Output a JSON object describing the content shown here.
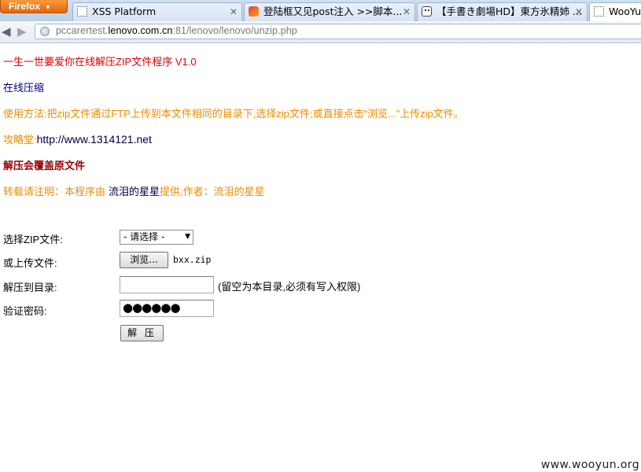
{
  "browser": {
    "app_button": "Firefox",
    "tabs": [
      {
        "label": "XSS Platform",
        "icon": "blank-page-icon",
        "active": false
      },
      {
        "label": "登陆框又见post注入 >>脚本...",
        "icon": "wooyun-favicon",
        "active": false
      },
      {
        "label": "【手書き劇場HD】東方氷精姉 ...",
        "icon": "bilibili-tv-icon",
        "active": false
      },
      {
        "label": "WooYu",
        "icon": "blank-page-icon",
        "active": true
      }
    ],
    "url": {
      "prefix": "pccarertest.",
      "domain": "lenovo.com.cn",
      "suffix": ":81/lenovo/lenovo/unzip.php"
    }
  },
  "page": {
    "title": "一生一世要爱你在线解压ZIP文件程序 V1.0",
    "subtitle": "在线压缩",
    "usage": "使用方法:把zip文件通过FTP上传到本文件相同的目录下,选择zip文件;或直接点击“浏览...”上传zip文件。",
    "site_prefix": "攻略堂:",
    "site_url": "http://www.1314121.net",
    "warning": "解压会覆盖原文件",
    "reprint_prefix": "转载请注明：本程序由",
    "reprint_author": "流泪的星星",
    "reprint_suffix": "提供,作者：流泪的星星"
  },
  "form": {
    "select_label": "选择ZIP文件:",
    "select_value": "- 请选择 -",
    "upload_label": "或上传文件:",
    "browse_button": "浏览...",
    "selected_file": "bxx.zip",
    "dir_label": "解压到目录:",
    "dir_value": "",
    "dir_hint": "(留空为本目录,必须有写入权限)",
    "password_label": "验证密码:",
    "password_mask": "●●●●●●",
    "submit_button": "解 压"
  },
  "watermark": "www.wooyun.org"
}
